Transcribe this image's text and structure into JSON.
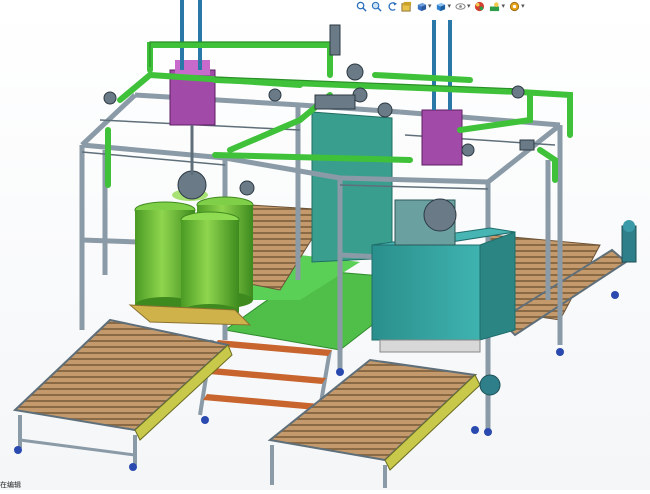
{
  "toolbar": {
    "items": [
      {
        "name": "zoom-to-fit-icon",
        "color": "#2a6fbd"
      },
      {
        "name": "zoom-area-icon",
        "color": "#2a6fbd"
      },
      {
        "name": "previous-view-icon",
        "color": "#2a6fbd"
      },
      {
        "name": "section-view-icon",
        "color": "#c9a227"
      },
      {
        "name": "view-orientation-icon",
        "color": "#3a72c4"
      },
      {
        "name": "display-style-icon",
        "color": "#2e7fd0"
      },
      {
        "name": "hide-show-items-icon",
        "color": "#8a8a8a"
      },
      {
        "name": "edit-appearance-icon",
        "color": "#d33f2f"
      },
      {
        "name": "apply-scene-icon",
        "color": "#2f9c47"
      },
      {
        "name": "view-settings-icon",
        "color": "#e8a317"
      }
    ]
  },
  "status": {
    "text": "在编辑"
  },
  "colors": {
    "frame": "#8a9aa6",
    "frame_dark": "#5f6f7a",
    "pipe": "#3fc23a",
    "pipe_dark": "#2a8f27",
    "tank": "#6fbf3a",
    "tank_dark": "#3f8a1f",
    "teal": "#2f9c9a",
    "conveyor_wood": "#c49a6c",
    "conveyor_dark": "#8a6a45",
    "floor": "#4fbf4a",
    "purple": "#a24aa8"
  }
}
